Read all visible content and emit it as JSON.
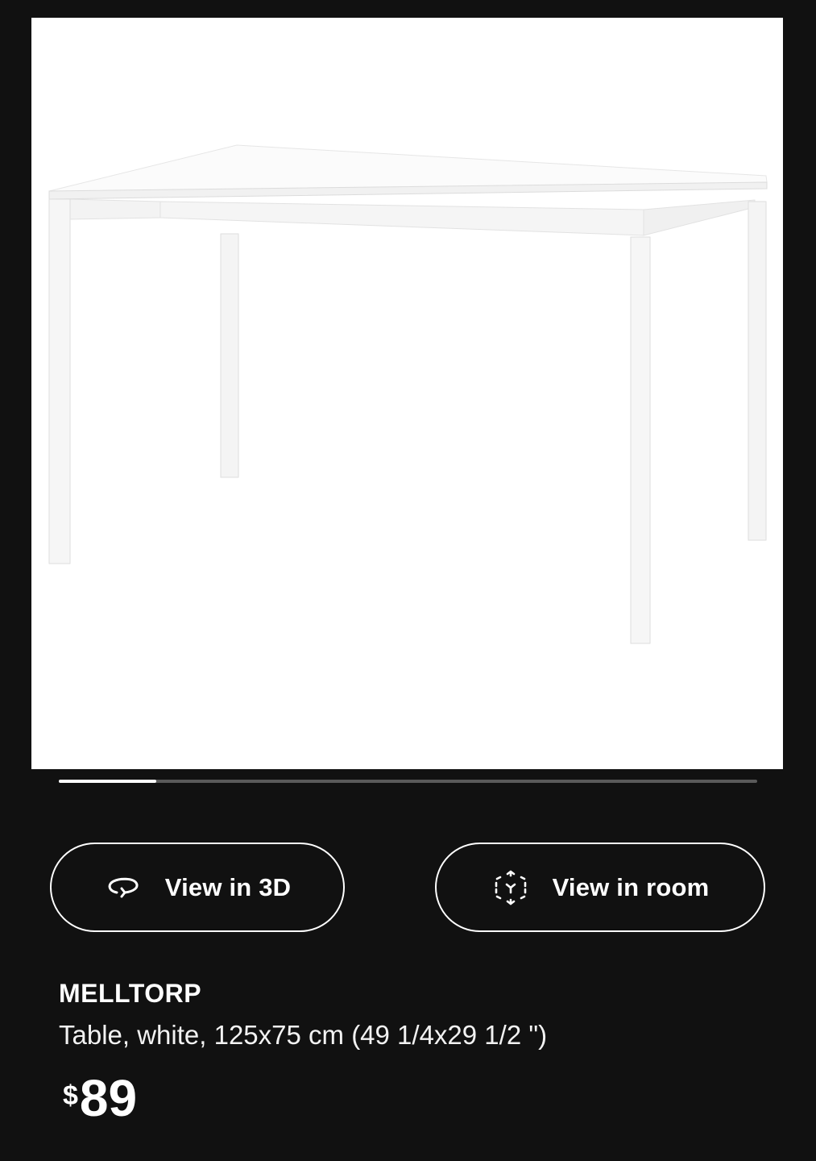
{
  "product": {
    "image_subject": "white table",
    "carousel_progress": 0.14,
    "name": "MELLTORP",
    "description": "Table, white, 125x75 cm (49 1/4x29 1/2 \")",
    "price_currency": "$",
    "price_amount": "89"
  },
  "actions": {
    "view_3d": {
      "label": "View in 3D",
      "icon": "rotate-3d-icon"
    },
    "view_room": {
      "label": "View in room",
      "icon": "ar-cube-icon"
    }
  },
  "colors": {
    "background": "#111111",
    "foreground": "#ffffff",
    "track": "#5a5a5a"
  }
}
